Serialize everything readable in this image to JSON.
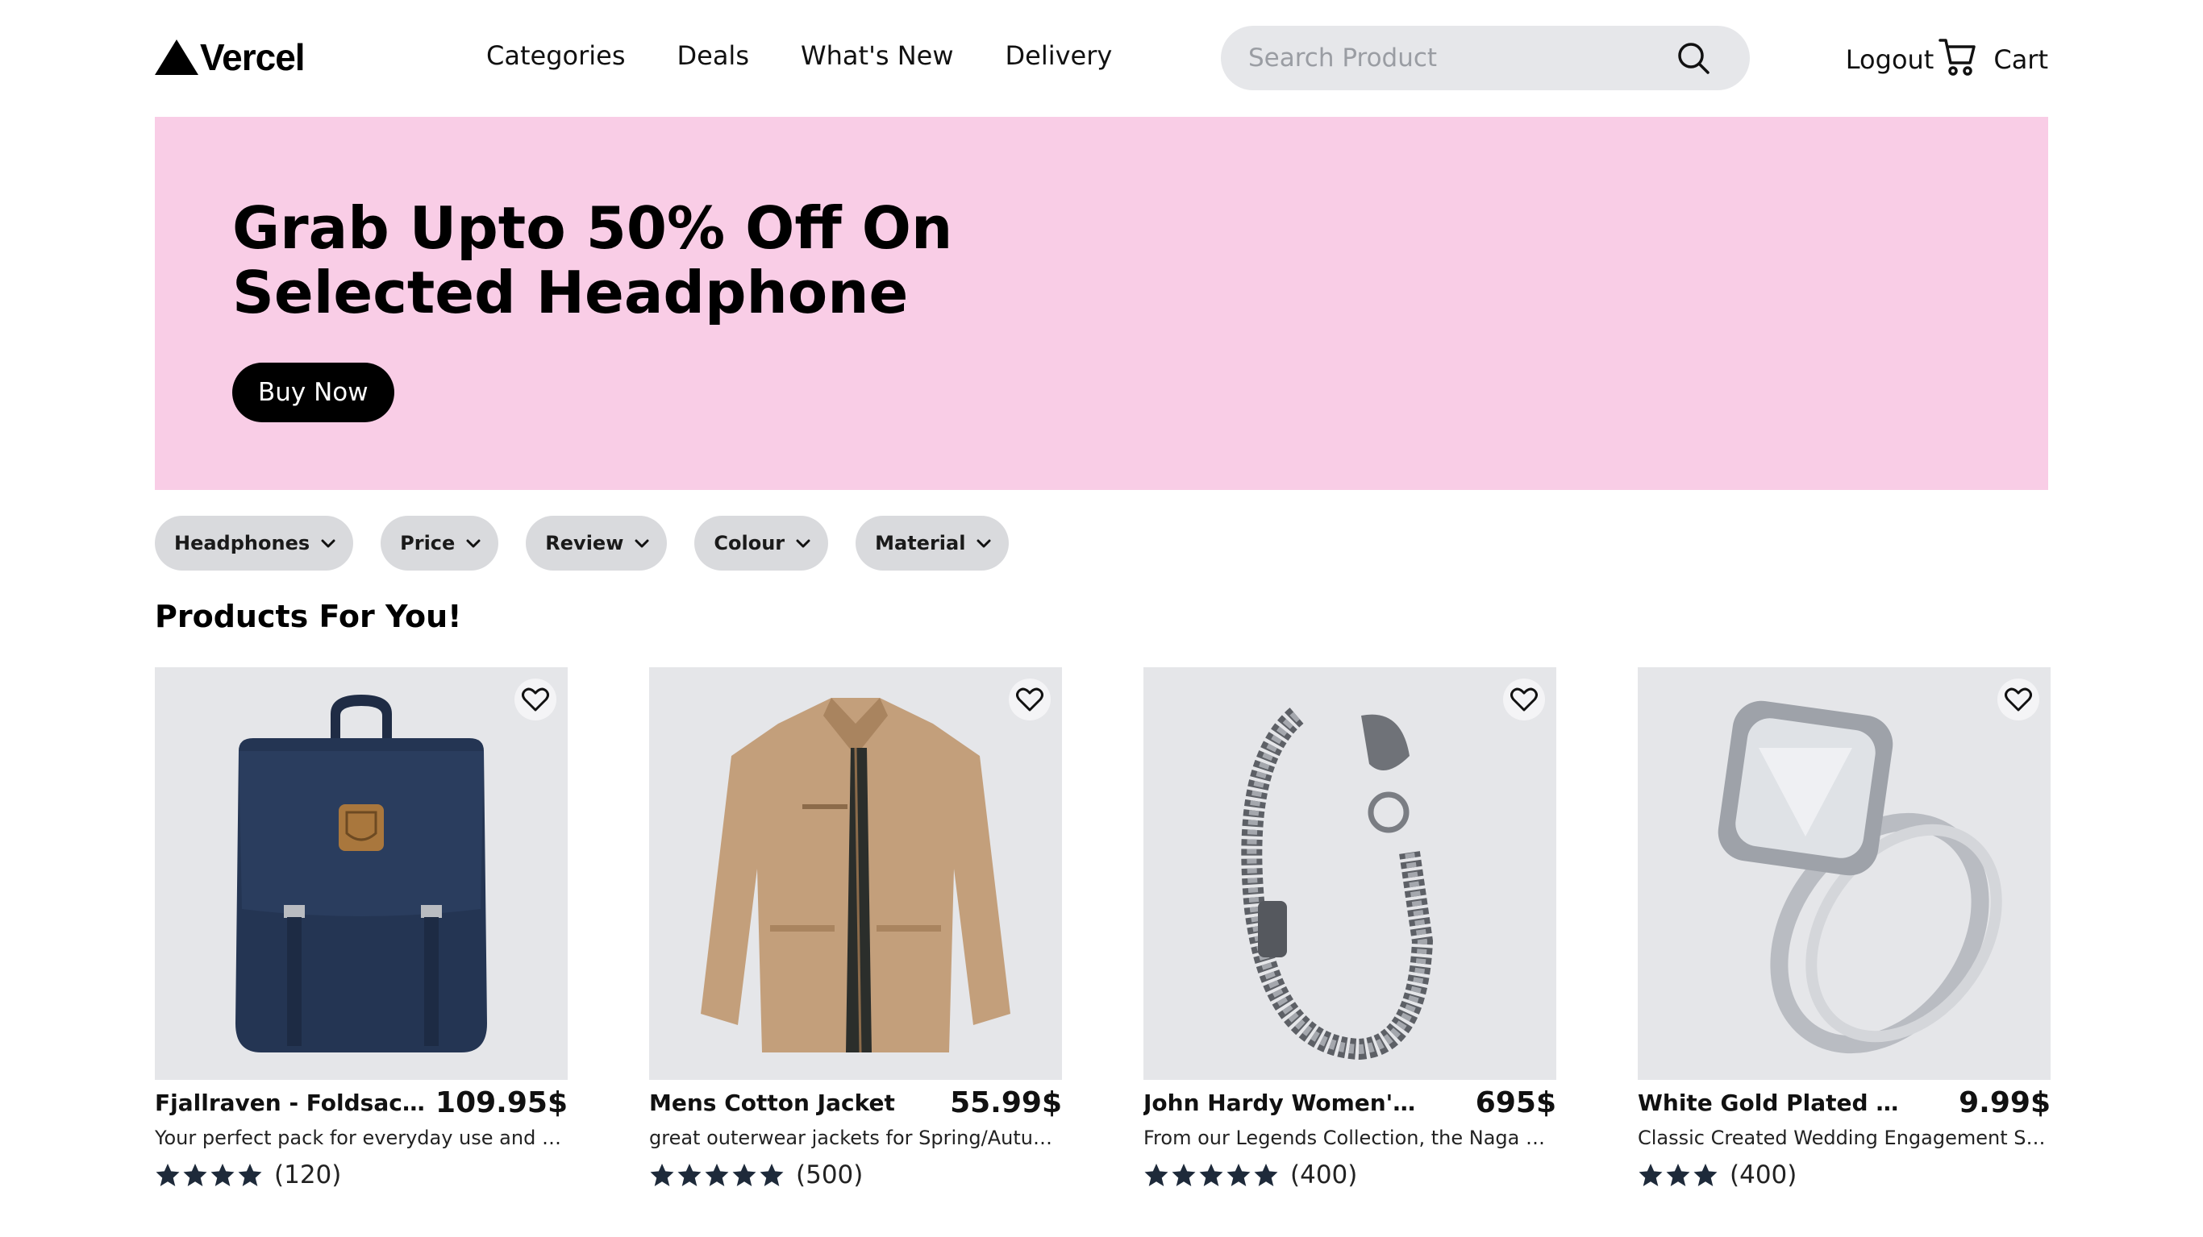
{
  "brand": {
    "name": "Vercel"
  },
  "nav": {
    "links": [
      "Categories",
      "Deals",
      "What's New",
      "Delivery"
    ]
  },
  "search": {
    "placeholder": "Search Product"
  },
  "account": {
    "logout": "Logout",
    "cart": "Cart"
  },
  "hero": {
    "title": "Grab Upto 50% Off On Selected Headphone",
    "cta": "Buy Now",
    "background": "#f9cde6"
  },
  "filters": [
    "Headphones",
    "Price",
    "Review",
    "Colour",
    "Material"
  ],
  "section_title": "Products For You!",
  "products": [
    {
      "name": "Fjallraven - Foldsack No...",
      "price": "109.95$",
      "description": "Your perfect pack for everyday use and walks i...",
      "stars": 4,
      "count": "(120)",
      "image": "backpack"
    },
    {
      "name": "Mens Cotton Jacket",
      "price": "55.99$",
      "description": "great outerwear jackets for Spring/Autumn/Wi...",
      "stars": 5,
      "count": "(500)",
      "image": "jacket"
    },
    {
      "name": "John Hardy Women's Legen...",
      "price": "695$",
      "description": "From our Legends Collection, the Naga was in...",
      "stars": 5,
      "count": "(400)",
      "image": "bracelet"
    },
    {
      "name": "White Gold Plated Princess",
      "price": "9.99$",
      "description": "Classic Created Wedding Engagement Solitaire...",
      "stars": 3,
      "count": "(400)",
      "image": "ring"
    }
  ],
  "colors": {
    "accent": "#000000",
    "chip_bg": "#d9dadd",
    "thumb_bg": "#e5e6e9",
    "star": "#1e2a3a"
  }
}
